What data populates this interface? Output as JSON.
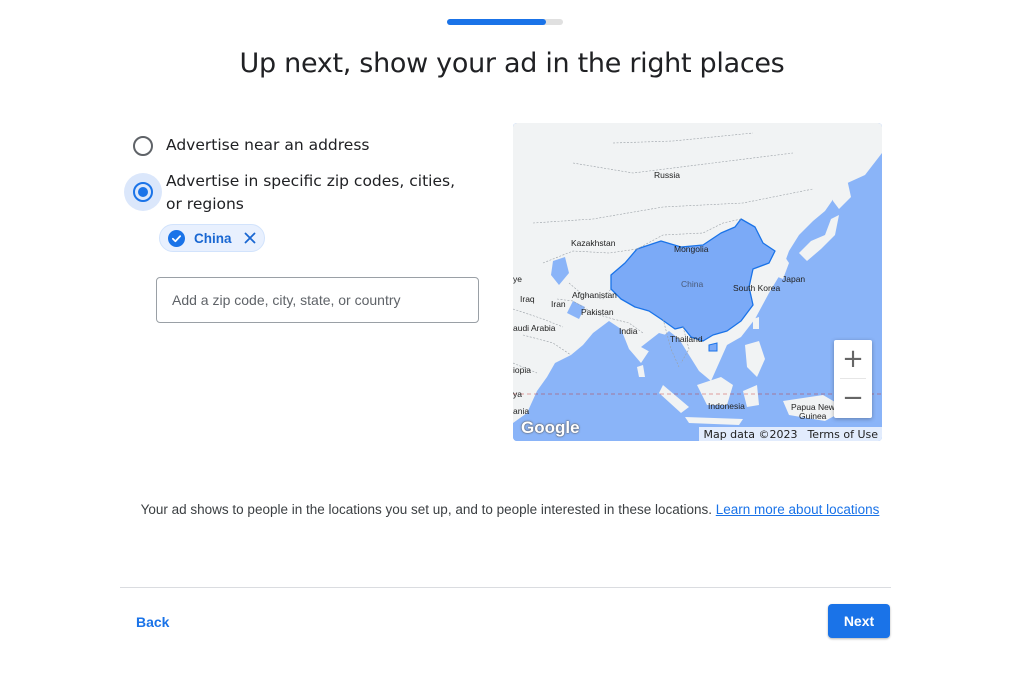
{
  "progress": {
    "fraction": 0.85
  },
  "page": {
    "title": "Up next, show your ad in the right places"
  },
  "location_options": [
    {
      "label": "Advertise near an address",
      "selected": false
    },
    {
      "label": "Advertise in specific zip codes, cities, or regions",
      "selected": true
    }
  ],
  "selected_location": {
    "label": "China",
    "icon": "check-circle-icon",
    "remove_icon": "close-icon"
  },
  "location_input": {
    "value": "",
    "placeholder": "Add a zip code, city, state, or country"
  },
  "map": {
    "labels": {
      "russia": "Russia",
      "kazakhstan": "Kazakhstan",
      "mongolia": "Mongolia",
      "japan": "Japan",
      "south_korea": "South Korea",
      "china": "China",
      "iran": "Iran",
      "iraq": "Iraq",
      "afghanistan": "Afghanistan",
      "pakistan": "Pakistan",
      "india": "India",
      "thailand": "Thailand",
      "saudi_arabia": "audi Arabia",
      "ethiopia": "iopia",
      "kenya": "ya",
      "tanzania": "ania",
      "indonesia": "Indonesia",
      "papua_line1": "Papua New",
      "papua_line2": "Guinea",
      "ye": "ye"
    },
    "logo": "Google",
    "attribution": "Map data ©2023",
    "terms": "Terms of Use",
    "zoom_in": "+",
    "zoom_out": "−"
  },
  "info": {
    "text": "Your ad shows to people in the locations you set up, and to people interested in these locations.",
    "link": "Learn more about locations"
  },
  "footer": {
    "back_label": "Back",
    "next_label": "Next"
  },
  "colors": {
    "accent": "#1a73e8",
    "water": "#8ab4f8",
    "land": "#f1f3f4",
    "highlight": "#7baaf7"
  }
}
